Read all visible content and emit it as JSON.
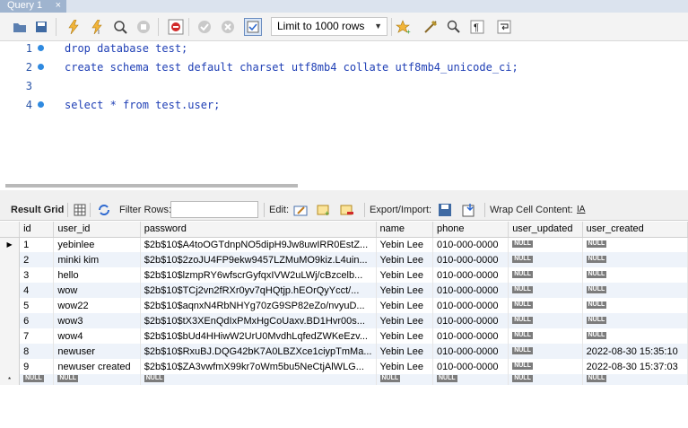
{
  "tab": {
    "title": "Query 1",
    "close": "×"
  },
  "toolbar": {
    "limit_value": "Limit to 1000 rows",
    "icons": [
      "open-folder-icon",
      "save-icon",
      "execute-icon",
      "execute-current-icon",
      "explain-icon",
      "stop-icon",
      "toggle-error-icon",
      "commit-icon",
      "rollback-icon",
      "autocommit-icon",
      "limit-select",
      "bookmark-icon",
      "beautify-icon",
      "find-icon",
      "invisible-chars-icon",
      "wrap-icon"
    ]
  },
  "editor": {
    "lines": [
      {
        "num": "1",
        "text": "drop database test;",
        "marker": true
      },
      {
        "num": "2",
        "text": "create schema test default charset utf8mb4 collate utf8mb4_unicode_ci;",
        "marker": true
      },
      {
        "num": "3",
        "text": "",
        "marker": false
      },
      {
        "num": "4",
        "text": "select * from test.user;",
        "marker": true
      }
    ]
  },
  "result_toolbar": {
    "result_grid": "Result Grid",
    "filter_rows": "Filter Rows:",
    "edit": "Edit:",
    "export_import": "Export/Import:",
    "wrap_cell": "Wrap Cell Content:",
    "wrap_icon": "IA"
  },
  "grid": {
    "columns": [
      "id",
      "user_id",
      "password",
      "name",
      "phone",
      "user_updated",
      "user_created"
    ],
    "null_label": "NULL",
    "rows": [
      [
        "1",
        "yebinlee",
        "$2b$10$A4toOGTdnpNO5dipH9Jw8uwIRR0EstZ...",
        "Yebin Lee",
        "010-000-0000",
        null,
        null
      ],
      [
        "2",
        "minki kim",
        "$2b$10$2zoJU4FP9ekw9457LZMuMO9kiz.L4uin...",
        "Yebin Lee",
        "010-000-0000",
        null,
        null
      ],
      [
        "3",
        "hello",
        "$2b$10$lzmpRY6wfscrGyfqxIVW2uLWj/cBzcelb...",
        "Yebin Lee",
        "010-000-0000",
        null,
        null
      ],
      [
        "4",
        "wow",
        "$2b$10$TCj2vn2fRXr0yv7qHQtjp.hEOrQyYcct/...",
        "Yebin Lee",
        "010-000-0000",
        null,
        null
      ],
      [
        "5",
        "wow22",
        "$2b$10$aqnxN4RbNHYg70zG9SP82eZo/nvyuD...",
        "Yebin Lee",
        "010-000-0000",
        null,
        null
      ],
      [
        "6",
        "wow3",
        "$2b$10$tX3XEnQdIxPMxHgCoUaxv.BD1Hvr00s...",
        "Yebin Lee",
        "010-000-0000",
        null,
        null
      ],
      [
        "7",
        "wow4",
        "$2b$10$bUd4HHiwW2UrU0MvdhLqfedZWKeEzv...",
        "Yebin Lee",
        "010-000-0000",
        null,
        null
      ],
      [
        "8",
        "newuser",
        "$2b$10$RxuBJ.DQG42bK7A0LBZXce1ciypTmMa...",
        "Yebin Lee",
        "010-000-0000",
        null,
        "2022-08-30 15:35:10"
      ],
      [
        "9",
        "newuser created",
        "$2b$10$ZA3vwfmX99kr7oWm5bu5NeCtjAlWLG...",
        "Yebin Lee",
        "010-000-0000",
        null,
        "2022-08-30 15:37:03"
      ]
    ],
    "new_row_marker": "*",
    "current_row_marker": "▶"
  }
}
